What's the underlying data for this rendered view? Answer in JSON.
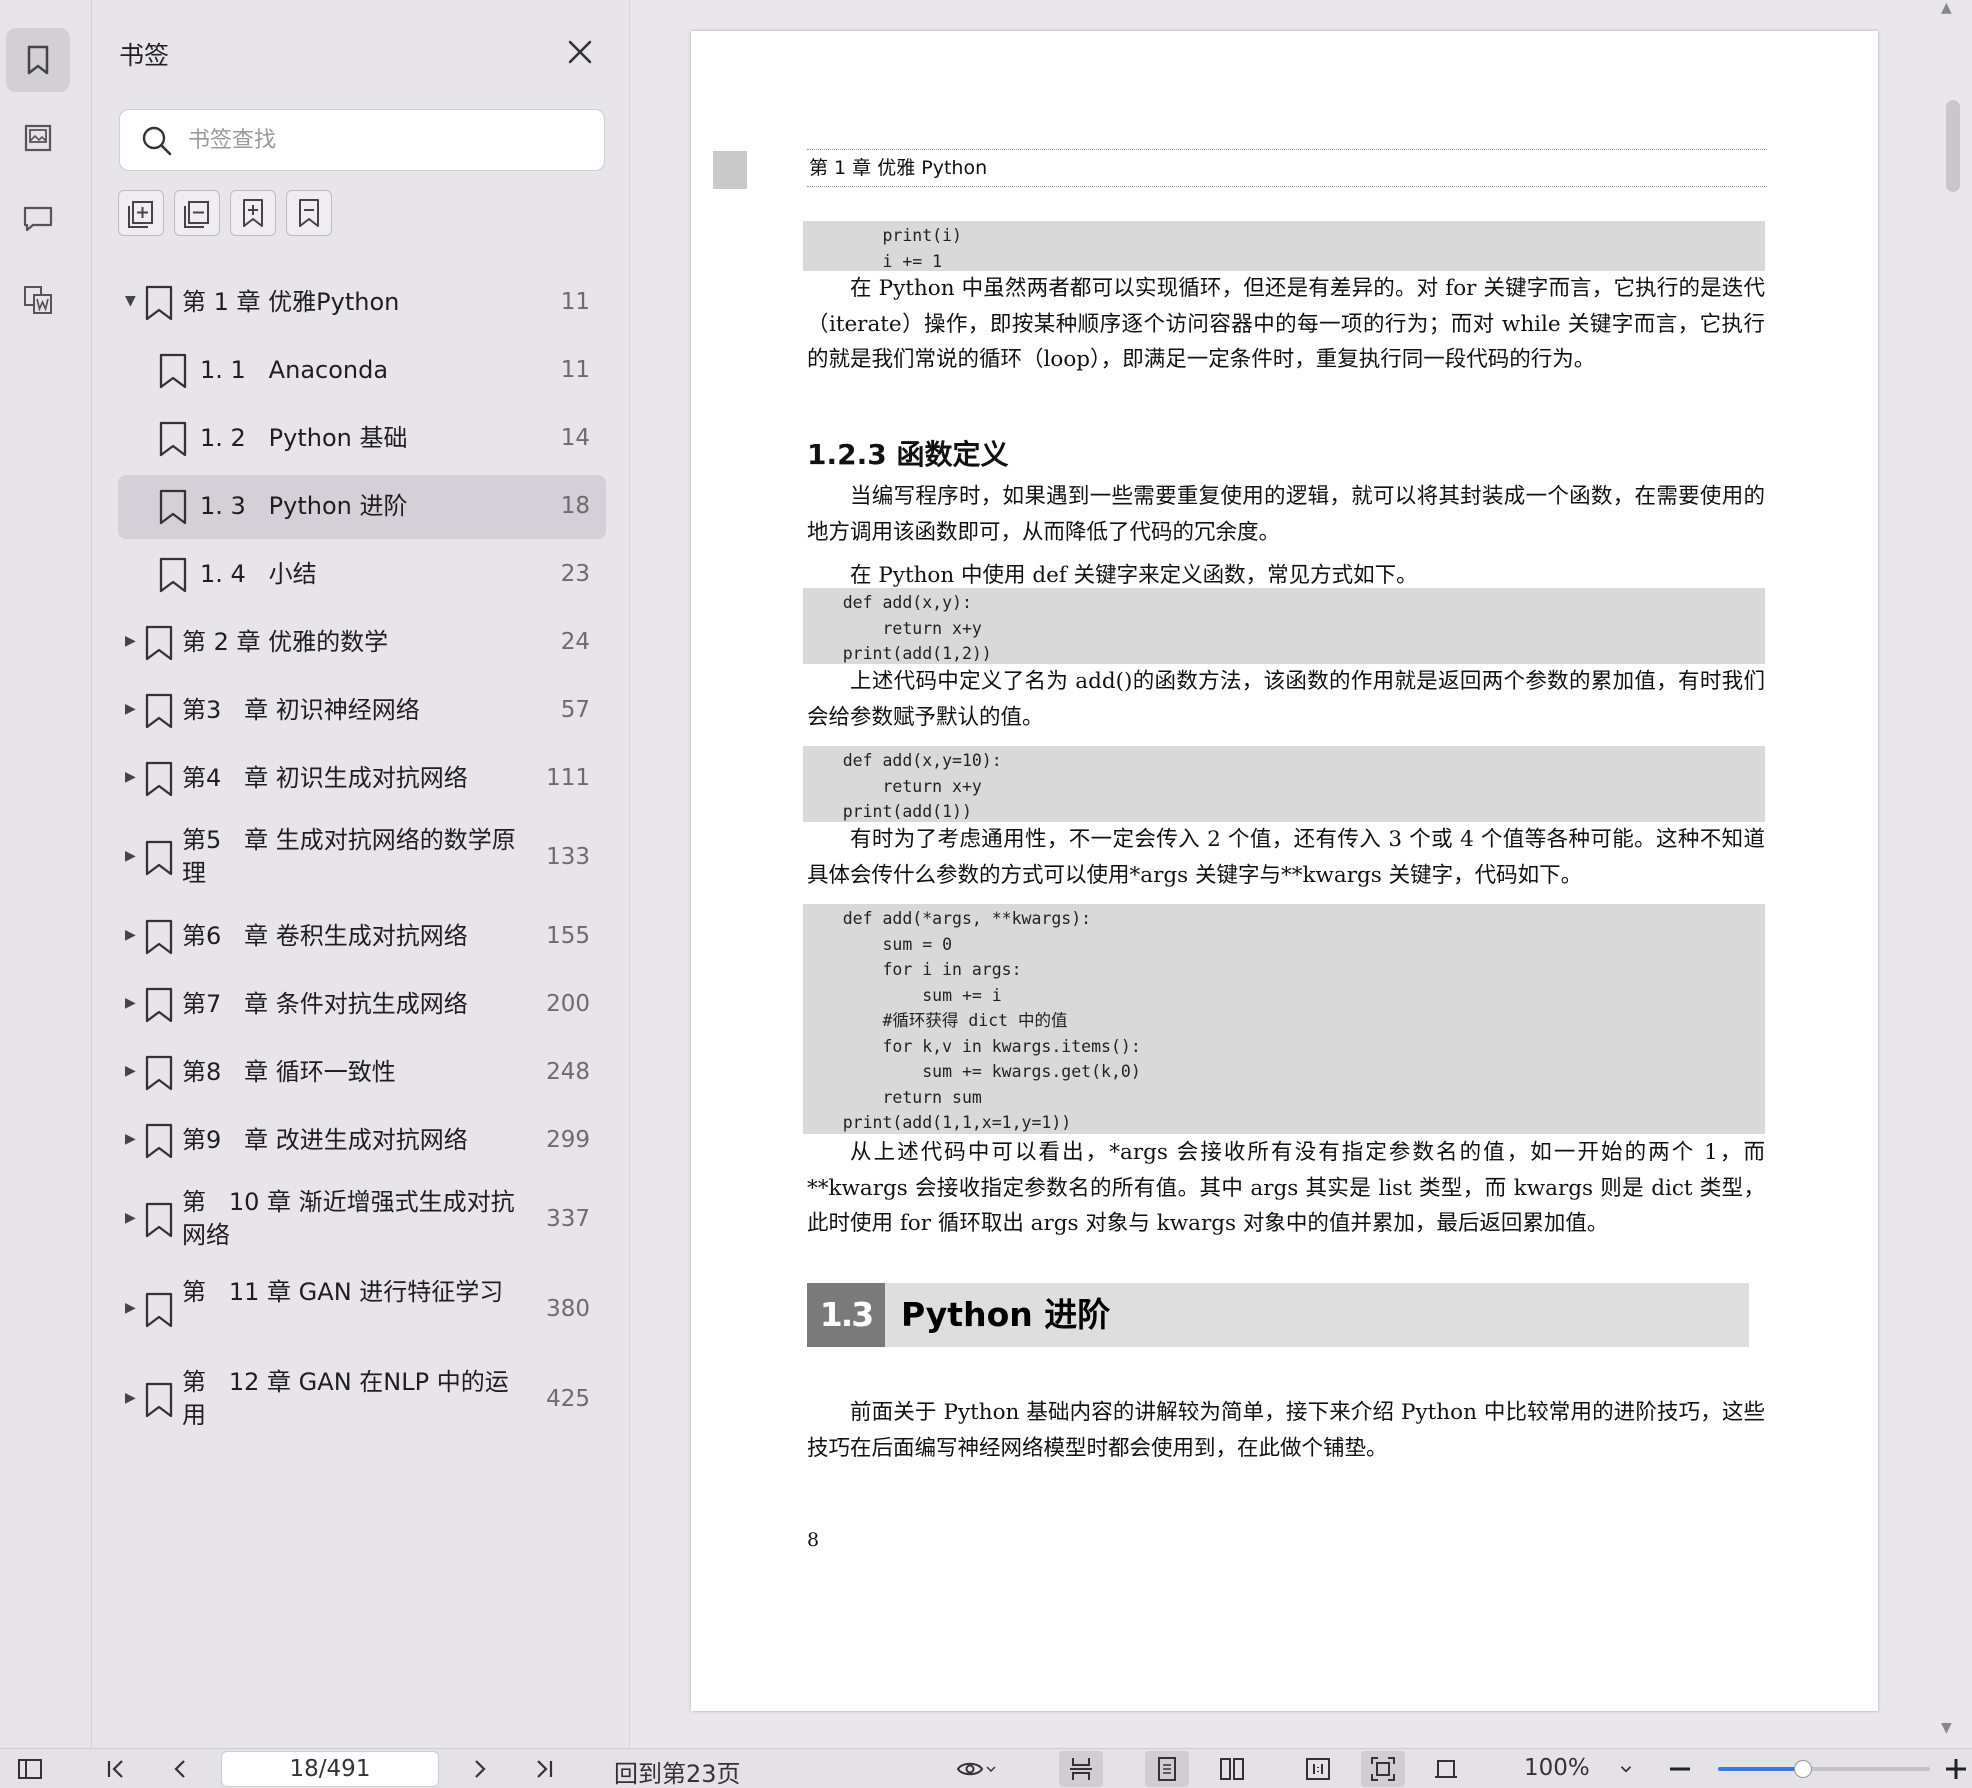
{
  "colors": {
    "accent": "#3b78e7",
    "selected_row": "#d3d1d7",
    "code_bg": "#d9d9d9"
  },
  "rail": {
    "items": [
      {
        "name": "bookmark-icon",
        "active": true
      },
      {
        "name": "image-thumbnail-icon",
        "active": false
      },
      {
        "name": "comment-icon",
        "active": false
      },
      {
        "name": "word-convert-icon",
        "active": false
      }
    ]
  },
  "bookmarks_panel": {
    "title": "书签",
    "search_placeholder": "书签查找",
    "tools": [
      "expand-all-icon",
      "collapse-all-icon",
      "add-bookmark-icon",
      "remove-bookmark-icon"
    ],
    "items": [
      {
        "label": "第 1 章 优雅Python",
        "page": "11",
        "level": 0,
        "expanded": true,
        "selected": false
      },
      {
        "label": "1. 1   Anaconda",
        "page": "11",
        "level": 1,
        "selected": false
      },
      {
        "label": "1. 2   Python 基础",
        "page": "14",
        "level": 1,
        "selected": false
      },
      {
        "label": "1. 3   Python 进阶",
        "page": "18",
        "level": 1,
        "selected": true
      },
      {
        "label": "1. 4   小结",
        "page": "23",
        "level": 1,
        "selected": false
      },
      {
        "label": "第 2 章 优雅的数学",
        "page": "24",
        "level": 0,
        "expanded": false,
        "selected": false
      },
      {
        "label": "第3   章 初识神经网络",
        "page": "57",
        "level": 0,
        "expanded": false,
        "selected": false
      },
      {
        "label": "第4   章 初识生成对抗网络",
        "page": "111",
        "level": 0,
        "expanded": false,
        "selected": false
      },
      {
        "label": "第5   章 生成对抗网络的数学原理",
        "page": "133",
        "level": 0,
        "expanded": false,
        "selected": false
      },
      {
        "label": "第6   章 卷积生成对抗网络",
        "page": "155",
        "level": 0,
        "expanded": false,
        "selected": false
      },
      {
        "label": "第7   章 条件对抗生成网络",
        "page": "200",
        "level": 0,
        "expanded": false,
        "selected": false
      },
      {
        "label": "第8   章 循环一致性",
        "page": "248",
        "level": 0,
        "expanded": false,
        "selected": false
      },
      {
        "label": "第9   章 改进生成对抗网络",
        "page": "299",
        "level": 0,
        "expanded": false,
        "selected": false
      },
      {
        "label": "第   10 章 渐近增强式生成对抗网络",
        "page": "337",
        "level": 0,
        "expanded": false,
        "selected": false
      },
      {
        "label": "第   11 章 GAN 进行特征学习",
        "page": "380",
        "level": 0,
        "expanded": false,
        "selected": false
      },
      {
        "label": "第   12 章 GAN 在NLP 中的运用",
        "page": "425",
        "level": 0,
        "expanded": false,
        "selected": false
      }
    ]
  },
  "document": {
    "running_header": "第 1 章   优雅 Python",
    "code1": "        print(i)\n        i += 1",
    "para1": "在 Python 中虽然两者都可以实现循环，但还是有差异的。对 for 关键字而言，它执行的是迭代（iterate）操作，即按某种顺序逐个访问容器中的每一项的行为；而对 while 关键字而言，它执行的就是我们常说的循环（loop），即满足一定条件时，重复执行同一段代码的行为。",
    "heading_1_2_3": "1.2.3   函数定义",
    "para2": "当编写程序时，如果遇到一些需要重复使用的逻辑，就可以将其封装成一个函数，在需要使用的地方调用该函数即可，从而降低了代码的冗余度。",
    "para3": "在 Python 中使用 def 关键字来定义函数，常见方式如下。",
    "code2": "    def add(x,y):\n        return x+y\n    print(add(1,2))",
    "para4": "上述代码中定义了名为 add()的函数方法，该函数的作用就是返回两个参数的累加值，有时我们会给参数赋予默认的值。",
    "code3": "    def add(x,y=10):\n        return x+y\n    print(add(1))",
    "para5": "有时为了考虑通用性，不一定会传入 2 个值，还有传入 3 个或 4 个值等各种可能。这种不知道具体会传什么参数的方式可以使用*args 关键字与**kwargs 关键字，代码如下。",
    "code4": "    def add(*args, **kwargs):\n        sum = 0\n        for i in args:\n            sum += i\n        #循环获得 dict 中的值\n        for k,v in kwargs.items():\n            sum += kwargs.get(k,0)\n        return sum\n    print(add(1,1,x=1,y=1))",
    "para6": "从上述代码中可以看出，*args 会接收所有没有指定参数名的值，如一开始的两个 1，而**kwargs 会接收指定参数名的所有值。其中 args 其实是 list 类型，而 kwargs 则是 dict 类型，此时使用 for 循环取出 args 对象与 kwargs 对象中的值并累加，最后返回累加值。",
    "section_number": "1.3",
    "section_title": "Python 进阶",
    "para7": "前面关于 Python 基础内容的讲解较为简单，接下来介绍 Python 中比较常用的进阶技巧，这些技巧在后面编写神经网络模型时都会使用到，在此做个铺垫。",
    "page_number": "8"
  },
  "bottombar": {
    "page_input": "18/491",
    "goto_label": "回到第23页",
    "zoom": "100%",
    "zoom_level": 0.4
  }
}
